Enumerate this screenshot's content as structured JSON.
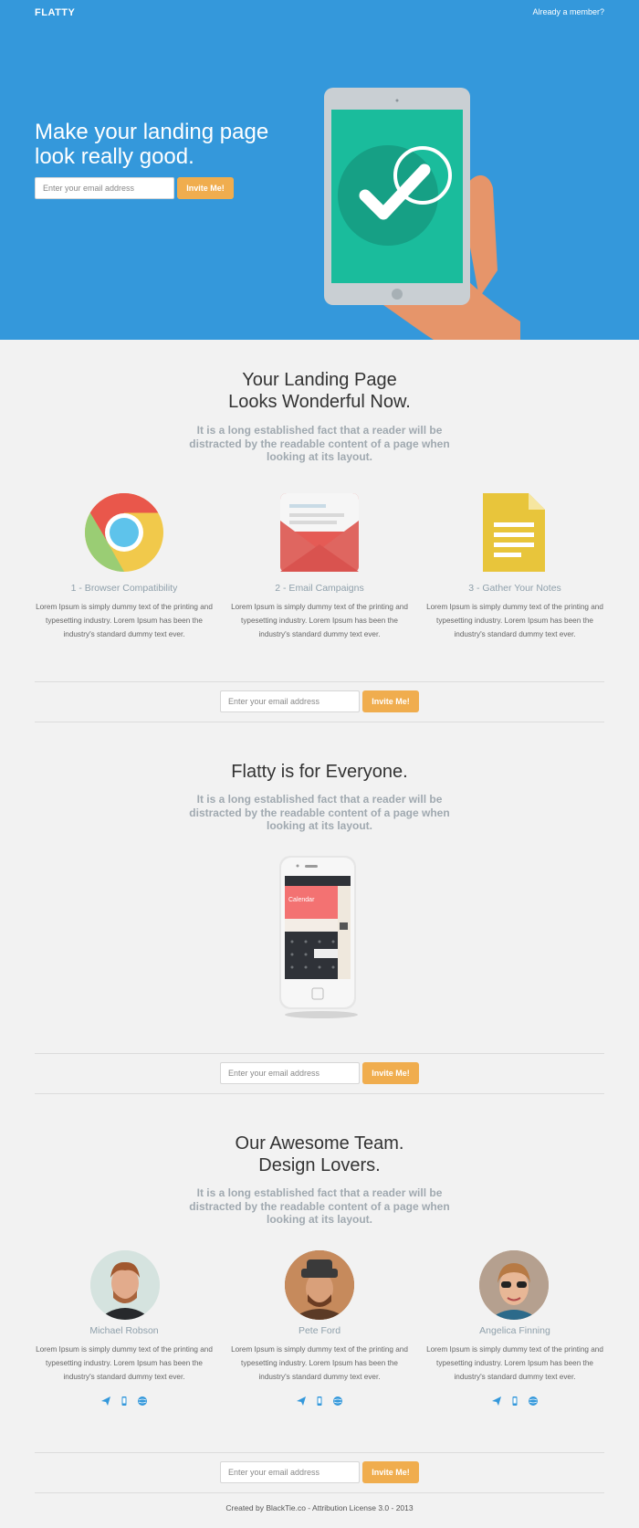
{
  "nav": {
    "brand": "FLATTY",
    "member_link": "Already a member?"
  },
  "hero": {
    "title": "Make your landing page look really good.",
    "email_placeholder": "Enter your email address",
    "button": "Invite Me!"
  },
  "features": {
    "title_line1": "Your Landing Page",
    "title_line2": "Looks Wonderful Now.",
    "subtitle": "It is a long established fact that a reader will be distracted by the readable content of a page when looking at its layout.",
    "items": [
      {
        "icon": "chrome-icon",
        "title": "1 - Browser Compatibility",
        "text": "Lorem Ipsum is simply dummy text of the printing and typesetting industry. Lorem Ipsum has been the industry's standard dummy text ever."
      },
      {
        "icon": "envelope-icon",
        "title": "2 - Email Campaigns",
        "text": "Lorem Ipsum is simply dummy text of the printing and typesetting industry. Lorem Ipsum has been the industry's standard dummy text ever."
      },
      {
        "icon": "notes-icon",
        "title": "3 - Gather Your Notes",
        "text": "Lorem Ipsum is simply dummy text of the printing and typesetting industry. Lorem Ipsum has been the industry's standard dummy text ever."
      }
    ]
  },
  "cta": {
    "email_placeholder": "Enter your email address",
    "button": "Invite Me!"
  },
  "everyone": {
    "title": "Flatty is for Everyone.",
    "subtitle": "It is a long established fact that a reader will be distracted by the readable content of a page when looking at its layout.",
    "phone_screen_title": "Calendar"
  },
  "team": {
    "title_line1": "Our Awesome Team.",
    "title_line2": "Design Lovers.",
    "subtitle": "It is a long established fact that a reader will be distracted by the readable content of a page when looking at its layout.",
    "members": [
      {
        "name": "Michael Robson",
        "text": "Lorem Ipsum is simply dummy text of the printing and typesetting industry. Lorem Ipsum has been the industry's standard dummy text ever."
      },
      {
        "name": "Pete Ford",
        "text": "Lorem Ipsum is simply dummy text of the printing and typesetting industry. Lorem Ipsum has been the industry's standard dummy text ever."
      },
      {
        "name": "Angelica Finning",
        "text": "Lorem Ipsum is simply dummy text of the printing and typesetting industry. Lorem Ipsum has been the industry's standard dummy text ever."
      }
    ],
    "social_icons": [
      "send-icon",
      "mobile-icon",
      "globe-icon"
    ]
  },
  "footer": {
    "text": "Created by BlackTie.co - Attribution License 3.0 - 2013"
  },
  "colors": {
    "hero_bg": "#3498db",
    "accent_button": "#f0ad4e",
    "page_bg": "#f2f2f2",
    "social_blue": "#3498db"
  }
}
